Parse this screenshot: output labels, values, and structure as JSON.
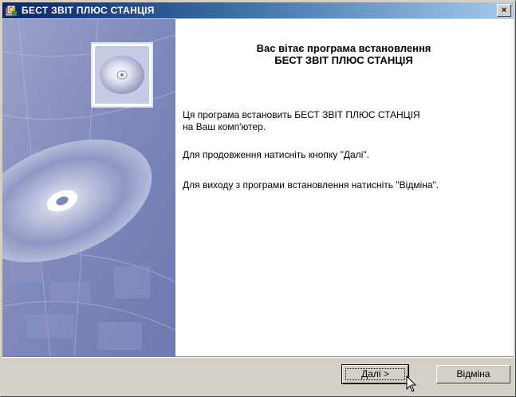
{
  "window": {
    "title": "БЕСТ ЗВІТ ПЛЮС СТАНЦІЯ",
    "close_glyph": "×"
  },
  "welcome": {
    "heading_line1": "Вас вітає програма встановлення",
    "heading_line2": "БЕСТ ЗВІТ ПЛЮС СТАНЦІЯ",
    "text_line1": "Ця програма встановить БЕСТ ЗВІТ ПЛЮС СТАНЦІЯ",
    "text_line2": "на Ваш комп'ютер.",
    "continue_text": "Для продовження натисніть кнопку \"Далі\".",
    "exit_text": "Для виходу з програми встановлення натисніть \"Відміна\"."
  },
  "buttons": {
    "next_accel": "Д",
    "next_rest": "алі >",
    "cancel_label": "Відміна"
  },
  "colors": {
    "titlebar_start": "#0a246a",
    "titlebar_end": "#a6caf0",
    "face": "#d4d0c8"
  }
}
